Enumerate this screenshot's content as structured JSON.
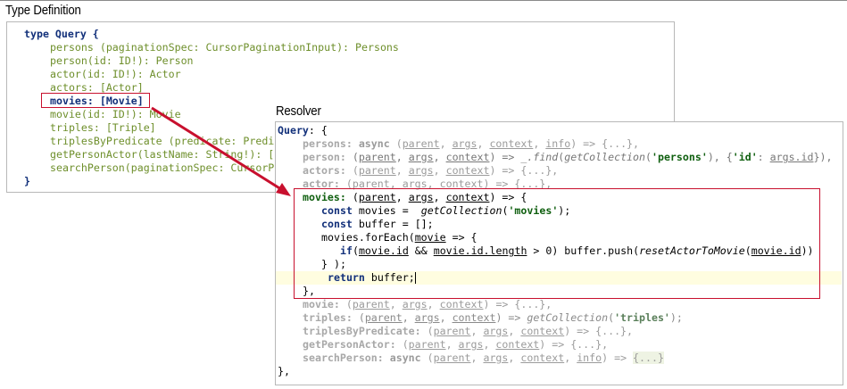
{
  "type_definition": {
    "heading": "Type Definition",
    "header": "type Query {",
    "fields": [
      "persons (paginationSpec: CursorPaginationInput): Persons",
      "person(id: ID!): Person",
      "actor(id: ID!): Actor",
      "actors: [Actor]",
      "movies: [Movie]",
      "movie(id: ID!): Movie",
      "triples: [Triple]",
      "triplesByPredicate (predicate: Predi",
      "getPersonActor(lastName: String!): [",
      "searchPerson(paginationSpec: CursorP"
    ],
    "closing": "}"
  },
  "resolver": {
    "heading": "Resolver",
    "header_key": "Query",
    "header_rest": ": {",
    "closing": "},",
    "tokens": {
      "persons": "persons:",
      "person": "person:",
      "actors": "actors:",
      "actor": "actor:",
      "movies": "movies:",
      "movie": "movie:",
      "triples": "triples:",
      "triplesByPredicate": "triplesByPredicate:",
      "getPersonActor": "getPersonActor:",
      "searchPerson": "searchPerson:",
      "async": "async",
      "parent": "parent",
      "args": "args",
      "context": "context",
      "info": "info",
      "open_paren": "(",
      "comma": ", ",
      "arrow_body": ") => ",
      "fold": "{...}",
      "trail_comma": ",",
      "find": "_.find",
      "getCollection": "getCollection",
      "persons_str": "'persons'",
      "id_str": "'id'",
      "args_id": "args.id",
      "close_call": "}),",
      "obj_open": "{",
      "colon_sp": ": ",
      "movies_str": "'movies'",
      "triples_str": "'triples'",
      "arrow_open": ") => {",
      "const": "const",
      "movies_var": "movies",
      "assign_pre": " = ",
      "call_open": "(",
      "call_close": ");",
      "buffer_decl": " buffer = [];",
      "movies_forEach": "movies.forEach(",
      "movie_param": "movie",
      "arrow_brace": " => {",
      "if_kw": "if",
      "movie_id": "movie.id",
      "and_op": " && ",
      "movie_id_length": "movie.id.length",
      "gt_zero": " > 0) buffer.push(",
      "resetActorToMovie": "resetActorToMovie",
      "close_parens": "))",
      "close_foreach": "} );",
      "return_kw": "return",
      "buffer_semi": " buffer;",
      "block_close": "},"
    }
  },
  "colors": {
    "highlight_border": "#c8102e",
    "arrow": "#c8102e",
    "active_line": "#fffde0",
    "keyword_olive": "#6e8f2b",
    "keyword_navy": "#12307a",
    "dim_text": "#9b9b9b"
  },
  "annotation": "red-arrow-from-movies-field-to-movies-resolver"
}
